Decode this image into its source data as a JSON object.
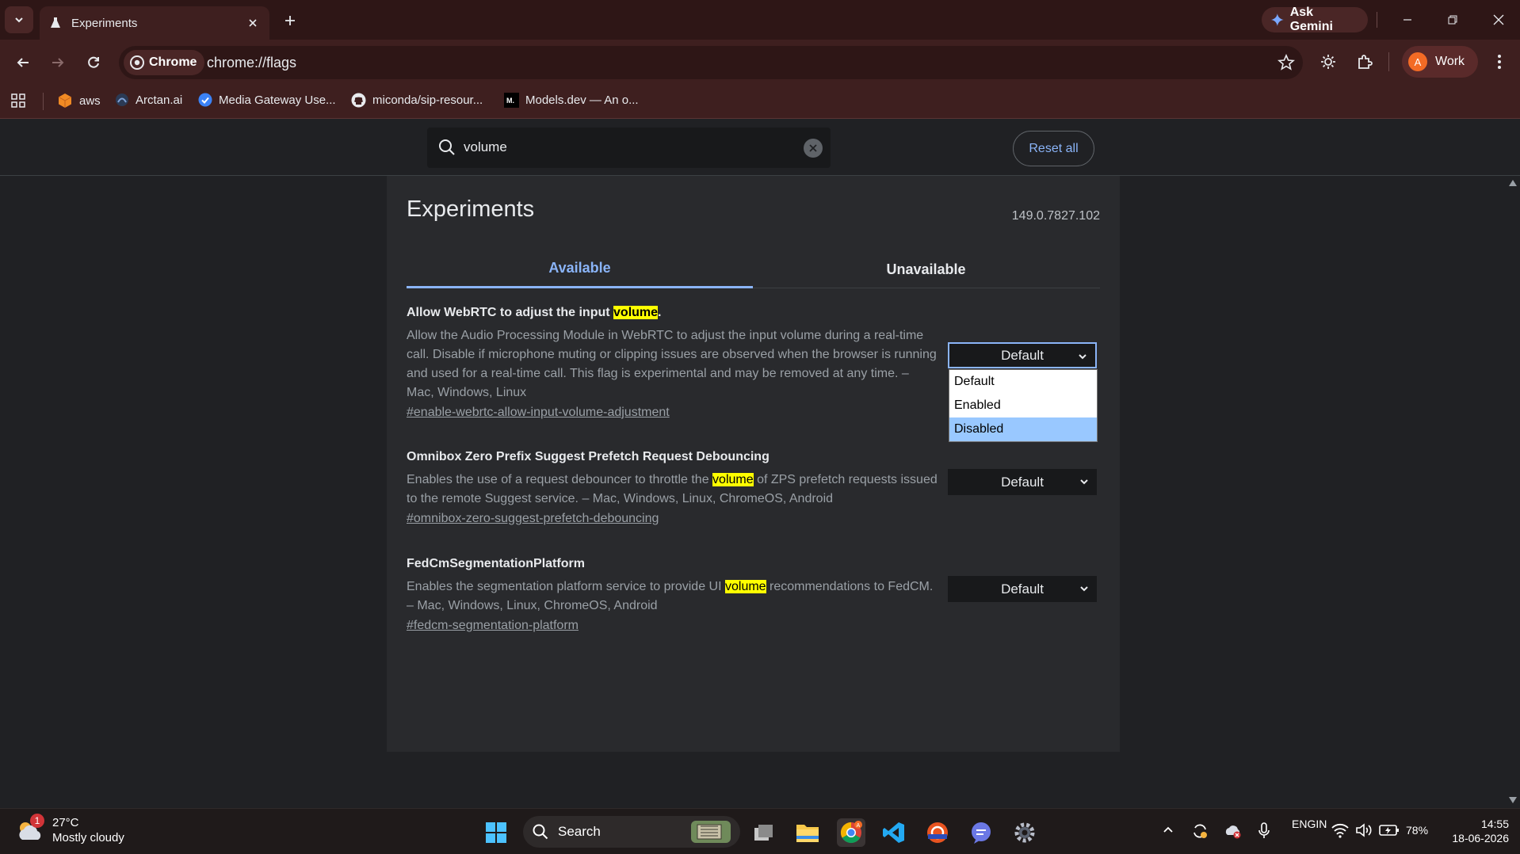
{
  "browser": {
    "tab_title": "Experiments",
    "ask_gemini_label": "Ask Gemini",
    "omnibox_chip": "Chrome",
    "url": "chrome://flags",
    "profile_initial": "A",
    "profile_label": "Work"
  },
  "bookmarks": [
    {
      "label": "aws"
    },
    {
      "label": "Arctan.ai"
    },
    {
      "label": "Media Gateway Use..."
    },
    {
      "label": "miconda/sip-resour..."
    },
    {
      "label": "Models.dev — An o..."
    }
  ],
  "flags_header": {
    "search_value": "volume",
    "reset_label": "Reset all"
  },
  "page": {
    "title": "Experiments",
    "version": "149.0.7827.102",
    "tabs": [
      {
        "label": "Available",
        "active": true
      },
      {
        "label": "Unavailable",
        "active": false
      }
    ]
  },
  "experiments": [
    {
      "title_pre": "Allow WebRTC to adjust the input ",
      "title_hl": "volume",
      "title_post": ".",
      "description": "Allow the Audio Processing Module in WebRTC to adjust the input volume during a real-time call. Disable if microphone muting or clipping issues are observed when the browser is running and used for a real-time call. This flag is experimental and may be removed at any time. – Mac, Windows, Linux",
      "link": "#enable-webrtc-allow-input-volume-adjustment",
      "value": "Default",
      "dropdown_open": true
    },
    {
      "title": "Omnibox Zero Prefix Suggest Prefetch Request Debouncing",
      "desc_pre": "Enables the use of a request debouncer to throttle the ",
      "desc_hl": "volume",
      "desc_post": " of ZPS prefetch requests issued to the remote Suggest service. – Mac, Windows, Linux, ChromeOS, Android",
      "link": "#omnibox-zero-suggest-prefetch-debouncing",
      "value": "Default"
    },
    {
      "title": "FedCmSegmentationPlatform",
      "desc_pre": "Enables the segmentation platform service to provide UI ",
      "desc_hl": "volume",
      "desc_post": " recommendations to FedCM. – Mac, Windows, Linux, ChromeOS, Android",
      "link": "#fedcm-segmentation-platform",
      "value": "Default"
    }
  ],
  "dropdown_options": [
    {
      "label": "Default",
      "selected": false
    },
    {
      "label": "Enabled",
      "selected": false
    },
    {
      "label": "Disabled",
      "selected": true
    }
  ],
  "taskbar": {
    "weather_badge": "1",
    "weather_temp": "27°C",
    "weather_desc": "Mostly cloudy",
    "search_label": "Search",
    "lang_line1": "ENG",
    "lang_line2": "IN",
    "battery": "78%",
    "time": "14:55",
    "date": "18-06-2026"
  },
  "colors": {
    "frame": "#2e1616",
    "toolbar": "#3e1f1f",
    "accent": "#8ab4f8",
    "highlight": "#ffff00"
  }
}
